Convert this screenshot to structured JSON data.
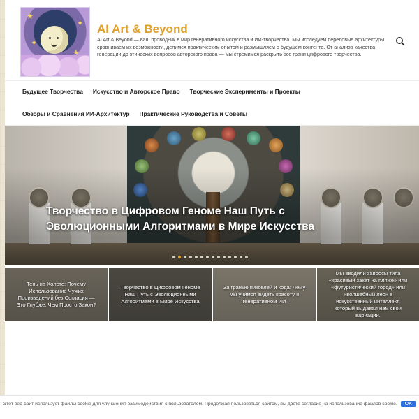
{
  "site": {
    "title": "AI Art & Beyond",
    "description": "AI Art & Beyond — ваш проводник в мир генеративного искусства и ИИ-творчества. Мы исследуем передовые архитектуры, сравниваем их возможности, делимся практическим опытом и размышляем о будущем контента. От анализа качества генерации до этических вопросов авторского права — мы стремимся раскрыть все грани цифрового творчества."
  },
  "icons": {
    "search": "search-icon",
    "logo": "moon-logo"
  },
  "colors": {
    "accent": "#e0a02c",
    "button": "#2f6fde"
  },
  "nav": {
    "row1": [
      "Будущее Творчества",
      "Искусство и Авторское Право",
      "Творческие Эксперименты и Проекты"
    ],
    "row2": [
      "Обзоры и Сравнения ИИ-Архитектур",
      "Практические Руководства и Советы"
    ]
  },
  "hero": {
    "title": "Творчество в Цифровом Геноме Наш Путь с Эволюционными Алгоритмами в Мире Искусства",
    "slide_count": 14,
    "active_slide": 1
  },
  "cards": [
    "Тень на Холсте: Почему Использование Чужих Произведений без Согласия — Это Глубже, Чем Просто Закон?",
    "Творчество в Цифровом Геноме Наш Путь с Эволюционными Алгоритмами в Мире Искусства",
    "За гранью пикселей и кода: Чему мы учимся видеть красоту в генеративном ИИ",
    "Мы вводили запросы типа «красивый закат на пляже» или «футуристический город» или «волшебный лес» в искусственный интеллект, который выдавал нам свои вариации."
  ],
  "cookie": {
    "text": "Этот веб-сайт использует файлы cookie для улучшения взаимодействия с пользователем. Продолжая пользоваться сайтом, вы даете согласие на использование файлов cookie.",
    "ok_label": "OK"
  }
}
